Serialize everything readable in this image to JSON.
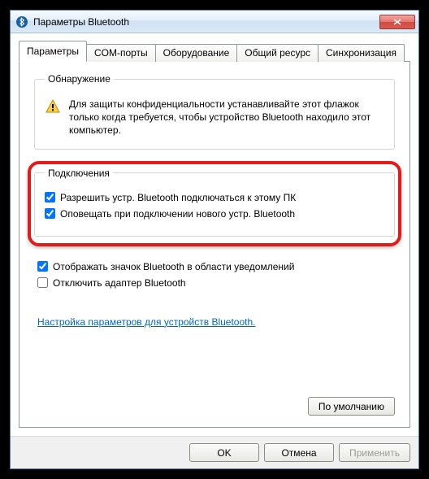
{
  "window": {
    "title": "Параметры Bluetooth"
  },
  "tabs": {
    "t0": "Параметры",
    "t1": "COM-порты",
    "t2": "Оборудование",
    "t3": "Общий ресурс",
    "t4": "Синхронизация"
  },
  "discovery": {
    "legend": "Обнаружение",
    "warning": "Для защиты конфиденциальности устанавливайте этот флажок только когда требуется, чтобы устройство Bluetooth находило этот компьютер."
  },
  "connections": {
    "legend": "Подключения",
    "allow": "Разрешить устр. Bluetooth подключаться к этому ПК",
    "notify": "Оповещать при подключении нового устр. Bluetooth"
  },
  "misc": {
    "showIcon": "Отображать значок Bluetooth в области уведомлений",
    "disableAdapter": "Отключить адаптер Bluetooth"
  },
  "link": "Настройка параметров для устройств Bluetooth.",
  "buttons": {
    "defaults": "По умолчанию",
    "ok": "OK",
    "cancel": "Отмена",
    "apply": "Применить"
  },
  "state": {
    "allowChecked": true,
    "notifyChecked": true,
    "showIconChecked": true,
    "disableAdapterChecked": false
  }
}
